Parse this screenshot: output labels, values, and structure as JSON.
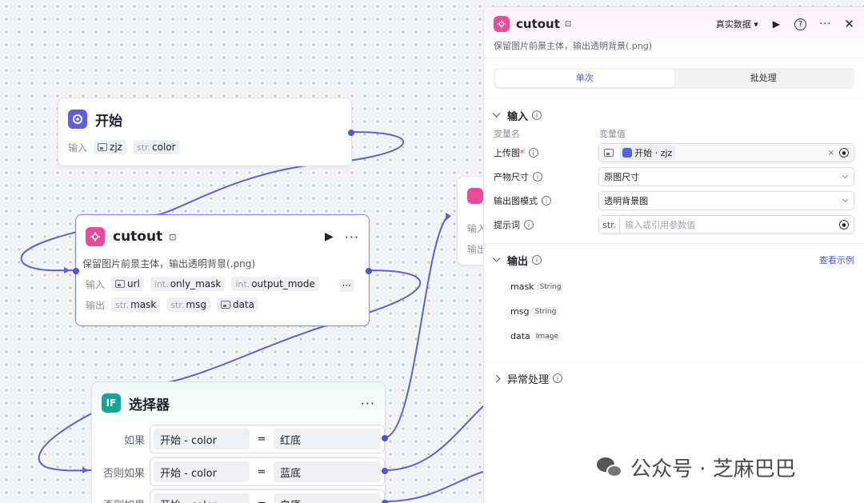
{
  "colors": {
    "accent": "#4e55d8",
    "start_icon": "#5b5fe3",
    "cutout_icon": "#e94b9a",
    "selector_icon": "#14a49a"
  },
  "start_node": {
    "title": "开始",
    "input_label": "输入",
    "inputs": [
      {
        "icon": "image-icon",
        "name": "zjz"
      },
      {
        "type": "str.",
        "name": "color"
      }
    ]
  },
  "cutout_node": {
    "title": "cutout",
    "description": "保留图片前景主体，输出透明背景(.png)",
    "input_label": "输入",
    "output_label": "输出",
    "inputs": [
      {
        "icon": "image-icon",
        "name": "url"
      },
      {
        "type": "int.",
        "name": "only_mask"
      },
      {
        "type": "int.",
        "name": "output_mode"
      }
    ],
    "outputs": [
      {
        "type": "str.",
        "name": "mask"
      },
      {
        "type": "str.",
        "name": "msg"
      },
      {
        "icon": "image-icon",
        "name": "data"
      }
    ]
  },
  "partial_node": {
    "input_label": "输入",
    "output_label": "输出"
  },
  "selector_node": {
    "title": "选择器",
    "conditions": [
      {
        "label": "如果",
        "left": "开始 - color",
        "op": "=",
        "right": "红底"
      },
      {
        "label": "否则如果",
        "left": "开始 - color",
        "op": "=",
        "right": "蓝底"
      },
      {
        "label": "否则如果",
        "left": "开始 - color",
        "op": "=",
        "right": "白底"
      }
    ]
  },
  "panel": {
    "title": "cutout",
    "subtitle": "保留图片前景主体，输出透明背景(.png)",
    "data_mode": "真实数据",
    "tabs": [
      "单次",
      "批处理"
    ],
    "input_section": "输入",
    "col_name": "变量名",
    "col_value": "变量值",
    "params": [
      {
        "label": "上传图",
        "required": true,
        "value_prefix": "开始 · zjz",
        "kind": "ref"
      },
      {
        "label": "产物尺寸",
        "value": "原图尺寸",
        "kind": "select"
      },
      {
        "label": "输出图模式",
        "value": "透明背景图",
        "kind": "select"
      },
      {
        "label": "提示词",
        "type": "str.",
        "placeholder": "输入或引用参数值",
        "kind": "text"
      }
    ],
    "output_section": "输出",
    "view_example": "查看示例",
    "outputs": [
      {
        "name": "mask",
        "type": "String"
      },
      {
        "name": "msg",
        "type": "String"
      },
      {
        "name": "data",
        "type": "Image"
      }
    ],
    "exception_section": "异常处理"
  },
  "watermark": "公众号 · 芝麻巴巴"
}
